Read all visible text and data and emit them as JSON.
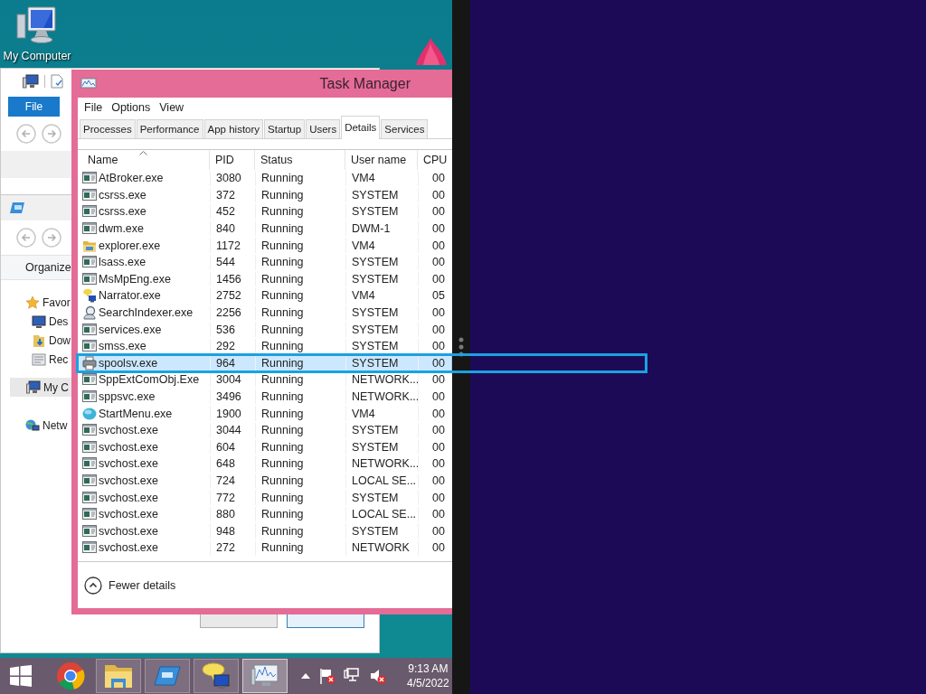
{
  "desktop": {
    "icons": [
      {
        "label": "My Computer"
      }
    ]
  },
  "explorer_back": {
    "file_tab": "File"
  },
  "explorer_front": {
    "toolbar": [
      "Organize"
    ],
    "nav_items": [
      {
        "label": "Favor",
        "kind": "favorites"
      },
      {
        "label": "Des",
        "kind": "desktop"
      },
      {
        "label": "Dow",
        "kind": "downloads"
      },
      {
        "label": "Rec",
        "kind": "recent"
      },
      {
        "label": "My C",
        "kind": "computer"
      },
      {
        "label": "Netw",
        "kind": "network"
      }
    ]
  },
  "task_manager": {
    "title": "Task Manager",
    "menu": [
      "File",
      "Options",
      "View"
    ],
    "tabs": [
      {
        "label": "Processes",
        "selected": false
      },
      {
        "label": "Performance",
        "selected": false
      },
      {
        "label": "App history",
        "selected": false
      },
      {
        "label": "Startup",
        "selected": false
      },
      {
        "label": "Users",
        "selected": false
      },
      {
        "label": "Details",
        "selected": true
      },
      {
        "label": "Services",
        "selected": false
      }
    ],
    "columns": [
      {
        "label": "Name",
        "sorted": true
      },
      {
        "label": "PID",
        "sorted": false
      },
      {
        "label": "Status",
        "sorted": false
      },
      {
        "label": "User name",
        "sorted": false
      },
      {
        "label": "CPU",
        "sorted": false
      }
    ],
    "rows": [
      {
        "kind": "app",
        "name": "AtBroker.exe",
        "pid": "3080",
        "status": "Running",
        "user": "VM4",
        "cpu": "00",
        "selected": false
      },
      {
        "kind": "app",
        "name": "csrss.exe",
        "pid": "372",
        "status": "Running",
        "user": "SYSTEM",
        "cpu": "00",
        "selected": false
      },
      {
        "kind": "app",
        "name": "csrss.exe",
        "pid": "452",
        "status": "Running",
        "user": "SYSTEM",
        "cpu": "00",
        "selected": false
      },
      {
        "kind": "app",
        "name": "dwm.exe",
        "pid": "840",
        "status": "Running",
        "user": "DWM-1",
        "cpu": "00",
        "selected": false
      },
      {
        "kind": "folder",
        "name": "explorer.exe",
        "pid": "1172",
        "status": "Running",
        "user": "VM4",
        "cpu": "00",
        "selected": false
      },
      {
        "kind": "app",
        "name": "lsass.exe",
        "pid": "544",
        "status": "Running",
        "user": "SYSTEM",
        "cpu": "00",
        "selected": false
      },
      {
        "kind": "app",
        "name": "MsMpEng.exe",
        "pid": "1456",
        "status": "Running",
        "user": "SYSTEM",
        "cpu": "00",
        "selected": false
      },
      {
        "kind": "narrator",
        "name": "Narrator.exe",
        "pid": "2752",
        "status": "Running",
        "user": "VM4",
        "cpu": "05",
        "selected": false
      },
      {
        "kind": "search",
        "name": "SearchIndexer.exe",
        "pid": "2256",
        "status": "Running",
        "user": "SYSTEM",
        "cpu": "00",
        "selected": false
      },
      {
        "kind": "app",
        "name": "services.exe",
        "pid": "536",
        "status": "Running",
        "user": "SYSTEM",
        "cpu": "00",
        "selected": false
      },
      {
        "kind": "app",
        "name": "smss.exe",
        "pid": "292",
        "status": "Running",
        "user": "SYSTEM",
        "cpu": "00",
        "selected": false
      },
      {
        "kind": "printer",
        "name": "spoolsv.exe",
        "pid": "964",
        "status": "Running",
        "user": "SYSTEM",
        "cpu": "00",
        "selected": true
      },
      {
        "kind": "app",
        "name": "SppExtComObj.Exe",
        "pid": "3004",
        "status": "Running",
        "user": "NETWORK...",
        "cpu": "00",
        "selected": false
      },
      {
        "kind": "app",
        "name": "sppsvc.exe",
        "pid": "3496",
        "status": "Running",
        "user": "NETWORK...",
        "cpu": "00",
        "selected": false
      },
      {
        "kind": "startmenu",
        "name": "StartMenu.exe",
        "pid": "1900",
        "status": "Running",
        "user": "VM4",
        "cpu": "00",
        "selected": false
      },
      {
        "kind": "app",
        "name": "svchost.exe",
        "pid": "3044",
        "status": "Running",
        "user": "SYSTEM",
        "cpu": "00",
        "selected": false
      },
      {
        "kind": "app",
        "name": "svchost.exe",
        "pid": "604",
        "status": "Running",
        "user": "SYSTEM",
        "cpu": "00",
        "selected": false
      },
      {
        "kind": "app",
        "name": "svchost.exe",
        "pid": "648",
        "status": "Running",
        "user": "NETWORK...",
        "cpu": "00",
        "selected": false
      },
      {
        "kind": "app",
        "name": "svchost.exe",
        "pid": "724",
        "status": "Running",
        "user": "LOCAL SE...",
        "cpu": "00",
        "selected": false
      },
      {
        "kind": "app",
        "name": "svchost.exe",
        "pid": "772",
        "status": "Running",
        "user": "SYSTEM",
        "cpu": "00",
        "selected": false
      },
      {
        "kind": "app",
        "name": "svchost.exe",
        "pid": "880",
        "status": "Running",
        "user": "LOCAL SE...",
        "cpu": "00",
        "selected": false
      },
      {
        "kind": "app",
        "name": "svchost.exe",
        "pid": "948",
        "status": "Running",
        "user": "SYSTEM",
        "cpu": "00",
        "selected": false
      },
      {
        "kind": "app",
        "name": "svchost.exe",
        "pid": "272",
        "status": "Running",
        "user": "NETWORK",
        "cpu": "00",
        "selected": false
      }
    ],
    "footer_button": "Fewer details"
  },
  "taskbar": {
    "items": [
      {
        "kind": "start",
        "running": false,
        "active": false
      },
      {
        "kind": "browser",
        "running": false,
        "active": false
      },
      {
        "kind": "folder",
        "running": true,
        "active": false
      },
      {
        "kind": "window",
        "running": true,
        "active": false
      },
      {
        "kind": "narrator",
        "running": true,
        "active": false
      },
      {
        "kind": "monitor",
        "running": true,
        "active": true
      }
    ],
    "tray": [
      {
        "kind": "flag",
        "alert": true
      },
      {
        "kind": "network",
        "alert": false
      },
      {
        "kind": "speaker",
        "alert": true
      }
    ],
    "clock": {
      "time": "9:13 AM",
      "date": "4/5/2022"
    }
  }
}
